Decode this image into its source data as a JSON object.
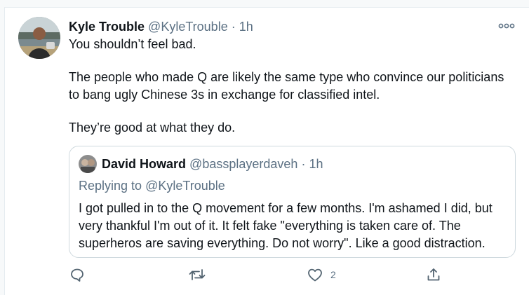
{
  "tweet": {
    "author_name": "Kyle Trouble",
    "author_handle": "@KyleTrouble",
    "separator": "·",
    "time": "1h",
    "paragraphs": [
      "You shouldn’t feel bad.",
      "The people who made Q are likely the same type who convince our politicians to bang ugly Chinese 3s in exchange for classified intel.",
      "They’re good at what they do."
    ],
    "more_icon": "more-horizontal-icon"
  },
  "quoted_tweet": {
    "author_name": "David Howard",
    "author_handle": "@bassplayerdaveh",
    "separator": "·",
    "time": "1h",
    "replying_prefix": "Replying to",
    "replying_to": "@KyleTrouble",
    "text": "I got pulled in to the Q movement for a few months. I'm ashamed I did, but very thankful I'm out of it. It felt fake \"everything is taken care of. The superheros are saving everything. Do not worry\". Like a good distraction."
  },
  "actions": {
    "reply_icon": "reply-icon",
    "retweet_icon": "retweet-icon",
    "like_icon": "heart-icon",
    "like_count": "2",
    "share_icon": "share-icon"
  },
  "colors": {
    "text": "#0f1419",
    "secondary": "#5b7083",
    "border": "#cfd9de",
    "icon": "#536471",
    "background": "#f7f9fa"
  }
}
